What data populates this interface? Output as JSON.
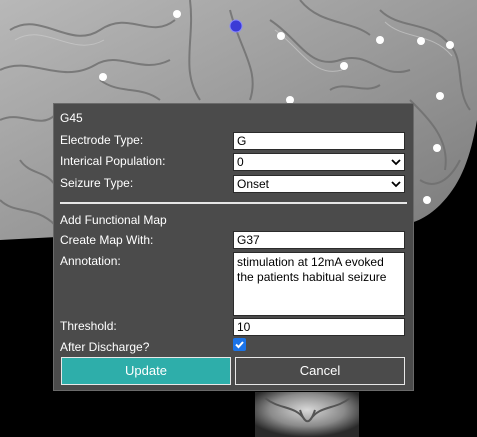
{
  "panel": {
    "title": "G45",
    "electrode_type_label": "Electrode Type:",
    "electrode_type_value": "G",
    "interical_population_label": "Interical Population:",
    "interical_population_value": "0",
    "seizure_type_label": "Seizure Type:",
    "seizure_type_value": "Onset",
    "functional_map_heading": "Add Functional Map",
    "create_map_label": "Create Map With:",
    "create_map_value": "G37",
    "annotation_label": "Annotation:",
    "annotation_value": "stimulation at 12mA evoked the patients habitual seizure",
    "threshold_label": "Threshold:",
    "threshold_value": "10",
    "after_discharge_label": "After Discharge?",
    "after_discharge_checked": true,
    "update_label": "Update",
    "cancel_label": "Cancel"
  },
  "colors": {
    "panel_bg": "#4b4b4b",
    "update_button": "#2eaeaa",
    "checkbox": "#1a73e8",
    "selected_electrode": "#3b3bd6",
    "electrode": "#ffffff"
  }
}
